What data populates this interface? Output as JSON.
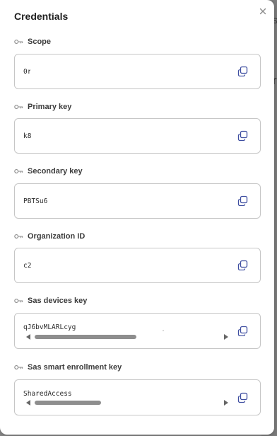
{
  "dialog": {
    "title": "Credentials",
    "close_icon": "close-icon"
  },
  "fields": [
    {
      "label": "Scope",
      "value": "0r",
      "icon": "key-icon",
      "copy_icon": "copy-icon"
    },
    {
      "label": "Primary key",
      "value": "k8",
      "icon": "key-icon",
      "copy_icon": "copy-icon"
    },
    {
      "label": "Secondary key",
      "value": "PBTSu6",
      "icon": "key-icon",
      "copy_icon": "copy-icon"
    },
    {
      "label": "Organization ID",
      "value": "c2",
      "icon": "key-icon",
      "copy_icon": "copy-icon"
    },
    {
      "label": "Sas devices key",
      "value": "qJ6bvMLARLcyg",
      "icon": "key-icon",
      "copy_icon": "copy-icon",
      "scroll_position": 0.55
    },
    {
      "label": "Sas smart enrollment key",
      "value": "SharedAccess",
      "icon": "key-icon",
      "copy_icon": "copy-icon",
      "scroll_position": 0.36
    }
  ],
  "background_page": {
    "fragments": [
      "s",
      "r"
    ]
  },
  "colors": {
    "copy_icon": "#3d4da0",
    "border": "#c6c6c6",
    "title": "#1f1f1f"
  }
}
